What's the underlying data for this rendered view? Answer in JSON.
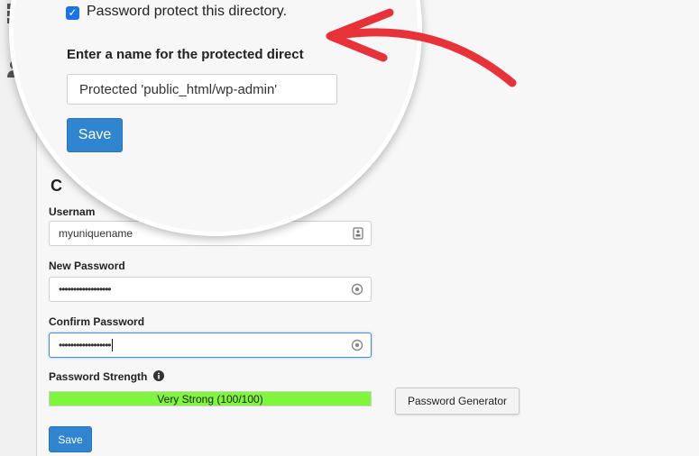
{
  "protect_checkbox": {
    "checked": true,
    "label": "Password protect this directory."
  },
  "directory_name": {
    "label": "Enter a name for the protected direct",
    "value": "Protected 'public_html/wp-admin'"
  },
  "protect_save_label": "Save",
  "user_section": {
    "heading_partial": "C",
    "username": {
      "label": "Usernam",
      "value": "myuniquename",
      "icon": "id-card-icon"
    },
    "new_password": {
      "label": "New Password",
      "value": "••••••••••••••••••",
      "icon": "password-reveal-icon"
    },
    "confirm_password": {
      "label": "Confirm Password",
      "value": "••••••••••••••••••",
      "icon": "password-reveal-icon"
    },
    "strength": {
      "label": "Password Strength",
      "info_icon": "info-icon",
      "text": "Very Strong (100/100)",
      "percent": 100
    },
    "generator_label": "Password Generator",
    "save_label": "Save"
  },
  "sidebar": {
    "icons": [
      "grid-icon",
      "users-icon"
    ]
  },
  "colors": {
    "primary": "#2f85cf",
    "strength": "#7ff53d",
    "arrow": "#e8323a",
    "checkbox": "#1a73e8"
  }
}
